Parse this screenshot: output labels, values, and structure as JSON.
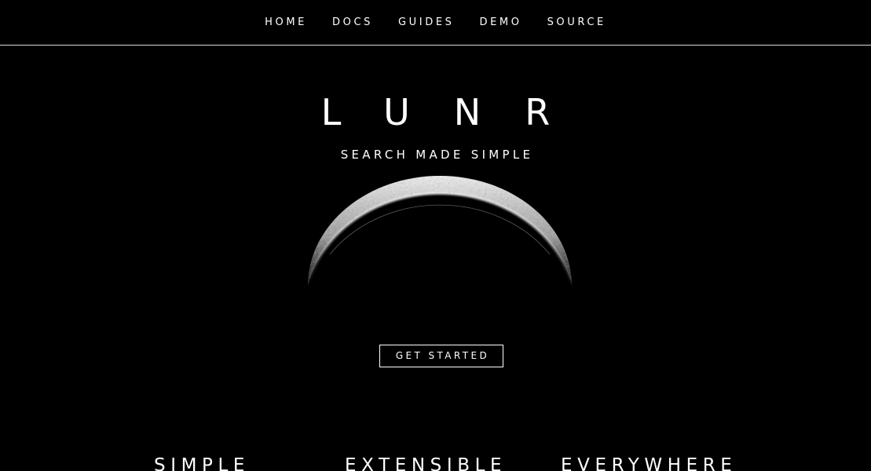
{
  "nav": {
    "items": [
      {
        "label": "HOME"
      },
      {
        "label": "DOCS"
      },
      {
        "label": "GUIDES"
      },
      {
        "label": "DEMO"
      },
      {
        "label": "SOURCE"
      }
    ]
  },
  "hero": {
    "title": "LUNR",
    "tagline": "SEARCH MADE SIMPLE",
    "image_icon": "crescent-moon",
    "cta_label": "GET STARTED"
  },
  "features": {
    "items": [
      {
        "heading": "SIMPLE"
      },
      {
        "heading": "EXTENSIBLE"
      },
      {
        "heading": "EVERYWHERE"
      }
    ]
  },
  "colors": {
    "background": "#000000",
    "text": "#ffffff",
    "nav_border": "#d8d8d8"
  }
}
